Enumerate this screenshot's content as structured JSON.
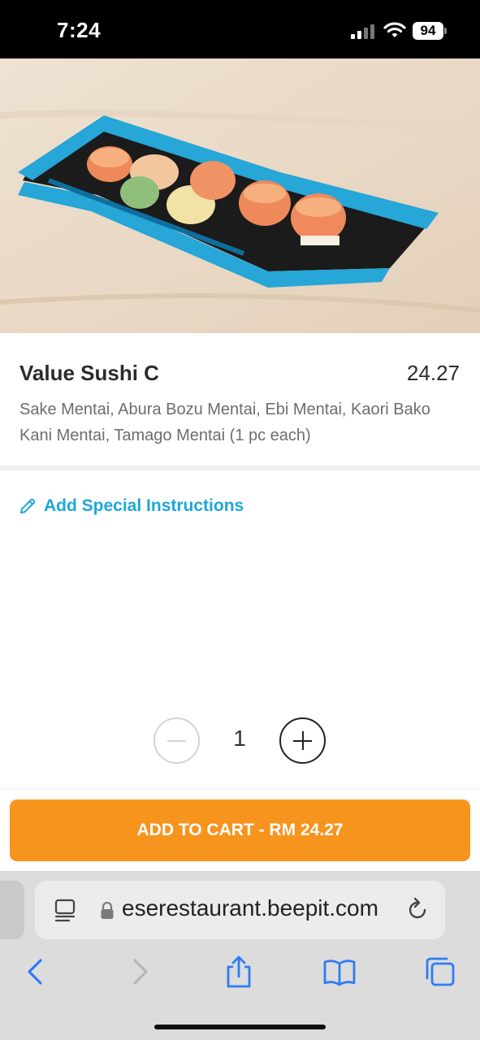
{
  "status_bar": {
    "time": "7:24",
    "battery_level": "94",
    "signal_icon": "cellular-signal-icon",
    "wifi_icon": "wifi-icon",
    "battery_icon": "battery-icon"
  },
  "product": {
    "name": "Value Sushi C",
    "price": "24.27",
    "description": "Sake Mentai, Abura Bozu Mentai, Ebi Mentai, Kaori Bako Kani Mentai, Tamago Mentai (1 pc each)"
  },
  "instructions": {
    "label": "Add Special Instructions",
    "icon": "pencil-icon"
  },
  "quantity": {
    "value": "1",
    "minus_icon": "minus-icon",
    "plus_icon": "plus-icon"
  },
  "cart": {
    "button_label": "ADD TO CART - RM 24.27"
  },
  "browser": {
    "url": "eserestaurant.beepit.com",
    "icons": {
      "reader": "reader-view-icon",
      "lock": "lock-icon",
      "reload": "reload-icon",
      "back": "back-icon",
      "forward": "forward-icon",
      "share": "share-icon",
      "bookmarks": "bookmarks-icon",
      "tabs": "tabs-icon"
    }
  },
  "colors": {
    "accent_blue": "#1ea7d8",
    "cart_orange": "#f7941d",
    "ios_blue": "#2f7cf6"
  }
}
